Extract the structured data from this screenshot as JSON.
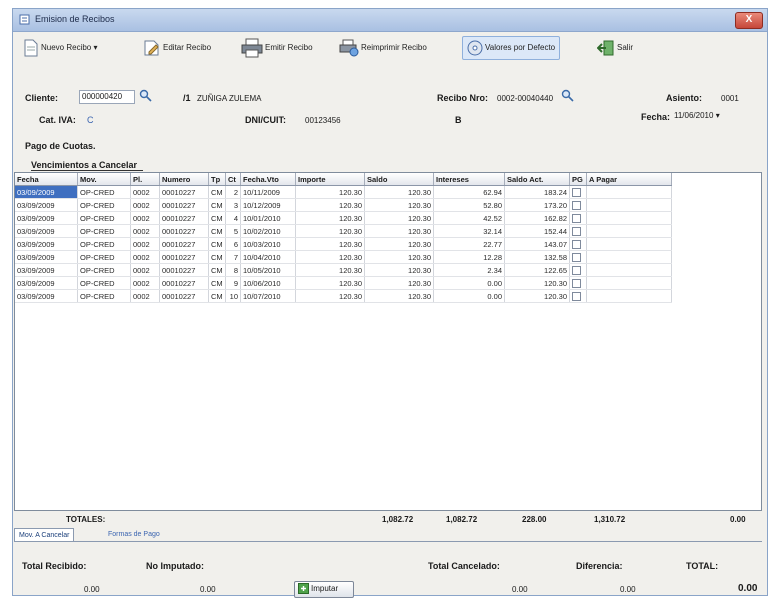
{
  "window": {
    "title": "Emision de Recibos",
    "close_label": "X"
  },
  "toolbar": {
    "nuevo": "Nuevo Recibo",
    "editar": "Editar Recibo",
    "emitir": "Emitir Recibo",
    "reimprimir": "Reimprimir Recibo",
    "valores": "Valores por Defecto",
    "salir": "Salir"
  },
  "header": {
    "cliente_label": "Cliente:",
    "cliente_value": "000000420",
    "cliente_code": "/1",
    "cliente_name": "ZUÑIGA ZULEMA",
    "recibo_label": "Recibo Nro:",
    "recibo_value": "0002-00040440",
    "asiento_label": "Asiento:",
    "asiento_value": "0001",
    "cativa_label": "Cat. IVA:",
    "cativa_value": "C",
    "dni_label": "DNI/CUIT:",
    "dni_value": "00123456",
    "b_value": "B",
    "fecha_label": "Fecha:",
    "fecha_value": "11/06/2010"
  },
  "section": {
    "pago_label": "Pago de Cuotas.",
    "venc_label": "Vencimientos a Cancelar"
  },
  "grid": {
    "columns": [
      "Fecha",
      "Mov.",
      "Pl.",
      "Numero",
      "Tp",
      "Ct",
      "Fecha.Vto",
      "Importe",
      "Saldo",
      "Intereses",
      "Saldo Act.",
      "PG",
      "A Pagar"
    ],
    "rows": [
      [
        "03/09/2009",
        "OP-CRED",
        "0002",
        "00010227",
        "CM",
        "2",
        "10/11/2009",
        "120.30",
        "120.30",
        "62.94",
        "183.24",
        ""
      ],
      [
        "03/09/2009",
        "OP-CRED",
        "0002",
        "00010227",
        "CM",
        "3",
        "10/12/2009",
        "120.30",
        "120.30",
        "52.80",
        "173.20",
        ""
      ],
      [
        "03/09/2009",
        "OP-CRED",
        "0002",
        "00010227",
        "CM",
        "4",
        "10/01/2010",
        "120.30",
        "120.30",
        "42.52",
        "162.82",
        ""
      ],
      [
        "03/09/2009",
        "OP-CRED",
        "0002",
        "00010227",
        "CM",
        "5",
        "10/02/2010",
        "120.30",
        "120.30",
        "32.14",
        "152.44",
        ""
      ],
      [
        "03/09/2009",
        "OP-CRED",
        "0002",
        "00010227",
        "CM",
        "6",
        "10/03/2010",
        "120.30",
        "120.30",
        "22.77",
        "143.07",
        ""
      ],
      [
        "03/09/2009",
        "OP-CRED",
        "0002",
        "00010227",
        "CM",
        "7",
        "10/04/2010",
        "120.30",
        "120.30",
        "12.28",
        "132.58",
        ""
      ],
      [
        "03/09/2009",
        "OP-CRED",
        "0002",
        "00010227",
        "CM",
        "8",
        "10/05/2010",
        "120.30",
        "120.30",
        "2.34",
        "122.65",
        ""
      ],
      [
        "03/09/2009",
        "OP-CRED",
        "0002",
        "00010227",
        "CM",
        "9",
        "10/06/2010",
        "120.30",
        "120.30",
        "0.00",
        "120.30",
        ""
      ],
      [
        "03/09/2009",
        "OP-CRED",
        "0002",
        "00010227",
        "CM",
        "10",
        "10/07/2010",
        "120.30",
        "120.30",
        "0.00",
        "120.30",
        ""
      ]
    ]
  },
  "totals": {
    "label": "TOTALES:",
    "importe": "1,082.72",
    "saldo": "1,082.72",
    "intereses": "228.00",
    "saldo_act": "1,310.72",
    "a_pagar": "0.00"
  },
  "tabs": [
    "Mov. A Cancelar",
    "Formas de Pago"
  ],
  "footer": {
    "total_recibido_label": "Total Recibido:",
    "total_recibido_value": "0.00",
    "no_imputado_label": "No Imputado:",
    "no_imputado_value": "0.00",
    "imputar_label": "Imputar",
    "total_cancelado_label": "Total Cancelado:",
    "total_cancelado_value": "0.00",
    "diferencia_label": "Diferencia:",
    "diferencia_value": "0.00",
    "total_label": "TOTAL:",
    "total_value": "0.00"
  },
  "colors": {
    "selected_row": "#3f6fc0",
    "title_bar": "#b9cdea",
    "close_button": "#c6473a"
  }
}
